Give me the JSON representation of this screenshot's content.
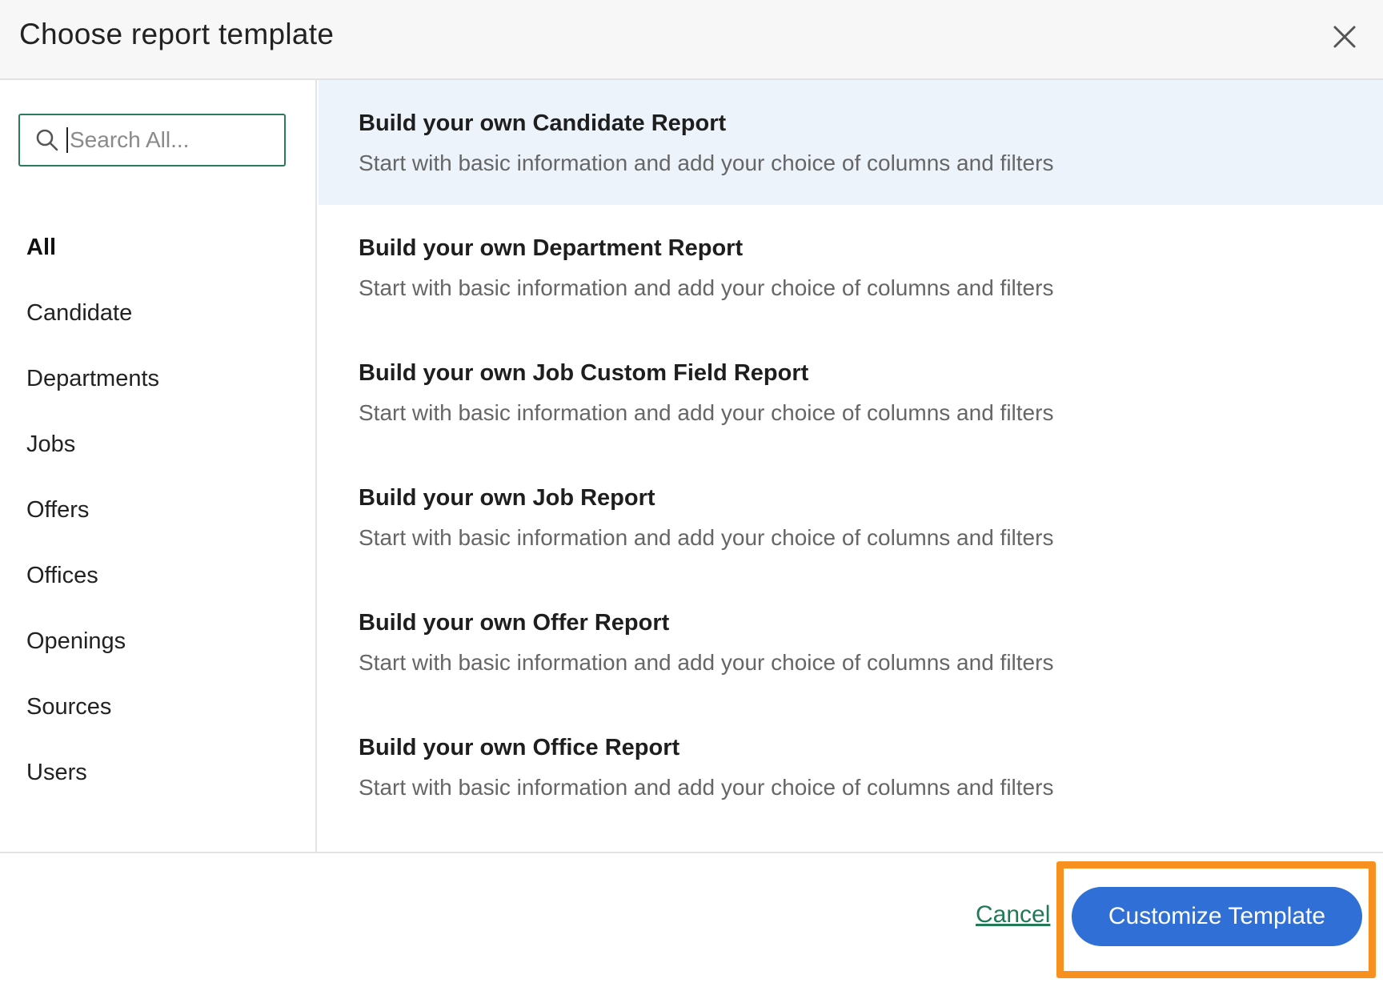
{
  "dialog": {
    "title": "Choose report template",
    "close_icon": "close-icon"
  },
  "sidebar": {
    "search": {
      "placeholder": "Search All...",
      "value": ""
    },
    "categories": [
      {
        "label": "All",
        "active": true
      },
      {
        "label": "Candidate"
      },
      {
        "label": "Departments"
      },
      {
        "label": "Jobs"
      },
      {
        "label": "Offers"
      },
      {
        "label": "Offices"
      },
      {
        "label": "Openings"
      },
      {
        "label": "Sources"
      },
      {
        "label": "Users"
      }
    ]
  },
  "templates": [
    {
      "title": "Build your own Candidate Report",
      "description": "Start with basic information and add your choice of columns and filters",
      "selected": true
    },
    {
      "title": "Build your own Department Report",
      "description": "Start with basic information and add your choice of columns and filters"
    },
    {
      "title": "Build your own Job Custom Field Report",
      "description": "Start with basic information and add your choice of columns and filters"
    },
    {
      "title": "Build your own Job Report",
      "description": "Start with basic information and add your choice of columns and filters"
    },
    {
      "title": "Build your own Offer Report",
      "description": "Start with basic information and add your choice of columns and filters"
    },
    {
      "title": "Build your own Office Report",
      "description": "Start with basic information and add your choice of columns and filters"
    }
  ],
  "footer": {
    "cancel_label": "Cancel",
    "customize_label": "Customize Template"
  },
  "colors": {
    "accent_green": "#2b7a5a",
    "link_green": "#1f7a55",
    "primary_blue": "#2f6fd6",
    "selected_row": "#ecf3fb",
    "highlight_orange": "#f7901e"
  }
}
